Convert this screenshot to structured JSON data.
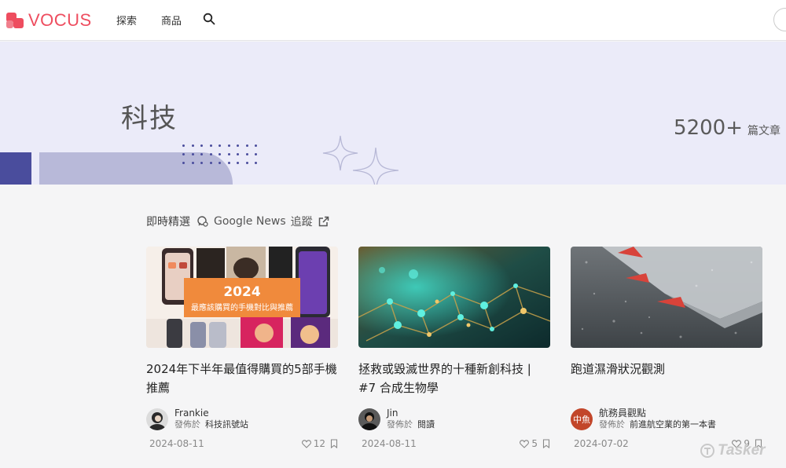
{
  "header": {
    "logo_text": "VOCUS",
    "nav": [
      {
        "label": "探索"
      },
      {
        "label": "商品"
      }
    ],
    "search_icon": "search-icon"
  },
  "banner": {
    "title": "科技",
    "count": "5200+",
    "count_label": "篇文章"
  },
  "section": {
    "title": "即時精選",
    "google_news": "Google News",
    "follow": "追蹤"
  },
  "articles": [
    {
      "title": "2024年下半年最值得購買的5部手機推薦",
      "image_headline": "2024",
      "image_subtitle": "最應該購買的手機對比與推薦",
      "author": "Frankie",
      "published_in_label": "發佈於",
      "published_in": "科技訊號站",
      "date": "2024-08-11",
      "likes": "12"
    },
    {
      "title": "拯救或毀滅世界的十種新創科技 | #7 合成生物學",
      "author": "Jin",
      "published_in_label": "發佈於",
      "published_in": "閱讀",
      "date": "2024-08-11",
      "likes": "5"
    },
    {
      "title": "跑道濕滑狀況觀測",
      "author": "航務員觀點",
      "avatar_text": "中魚",
      "published_in_label": "發佈於",
      "published_in": "前進航空業的第一本書",
      "date": "2024-07-02",
      "likes": "9"
    }
  ],
  "watermark": "Tasker",
  "colors": {
    "brand": "#ee4d5f",
    "banner_bg": "#ebebf9",
    "accent_deep": "#4a4d9d",
    "accent_soft": "#b8b9d9",
    "page_bg": "#f5f5f6"
  }
}
